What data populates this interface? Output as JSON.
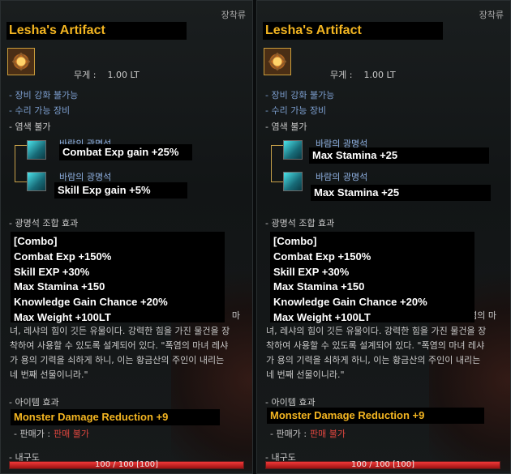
{
  "category": "장착류",
  "item": {
    "name": "Lesha's Artifact",
    "weight_label": "무게 :",
    "weight_value": "1.00 LT"
  },
  "properties": {
    "enhance": "- 장비 강화 불가능",
    "repair": "- 수리 가능 장비",
    "dye": "- 염색 불가"
  },
  "sockets": {
    "crystal_name": "바람의 광명석",
    "left": [
      "Combat Exp gain +25%",
      "Skill Exp gain +5%"
    ],
    "right": [
      "Max Stamina +25",
      "Max Stamina +25"
    ]
  },
  "combo": {
    "heading": "- 광명석 조합 효과",
    "lines": [
      "[Combo]",
      "Combat Exp +150%",
      "Skill EXP +30%",
      "Max Stamina +150",
      "Knowledge Gain Chance +20%",
      "Max Weight +100LT"
    ]
  },
  "description": {
    "frag_left": "마",
    "frag_right": "염의 마",
    "lines": [
      "녀, 레샤의 힘이 깃든 유물이다. 강력한 힘을 가진 물건을 장",
      "착하여 사용할 수 있도록 설계되어 있다. \"폭염의 마녀 레샤",
      "가 용의 기력을 쇠하게 하니, 이는 황금산의 주인이 내리는",
      "네 번째 선물이니라.\""
    ]
  },
  "effects": {
    "heading": "- 아이템 효과",
    "value": "Monster Damage Reduction +9"
  },
  "sell": {
    "label": "- 판매가 :",
    "value": "판매 불가"
  },
  "durability": {
    "label": "- 내구도",
    "text": "100 / 100 [100]",
    "fraction": 1.0
  },
  "colors": {
    "title": "#f3b521",
    "durability": "#ef3a3a",
    "negative": "#e1473f"
  }
}
